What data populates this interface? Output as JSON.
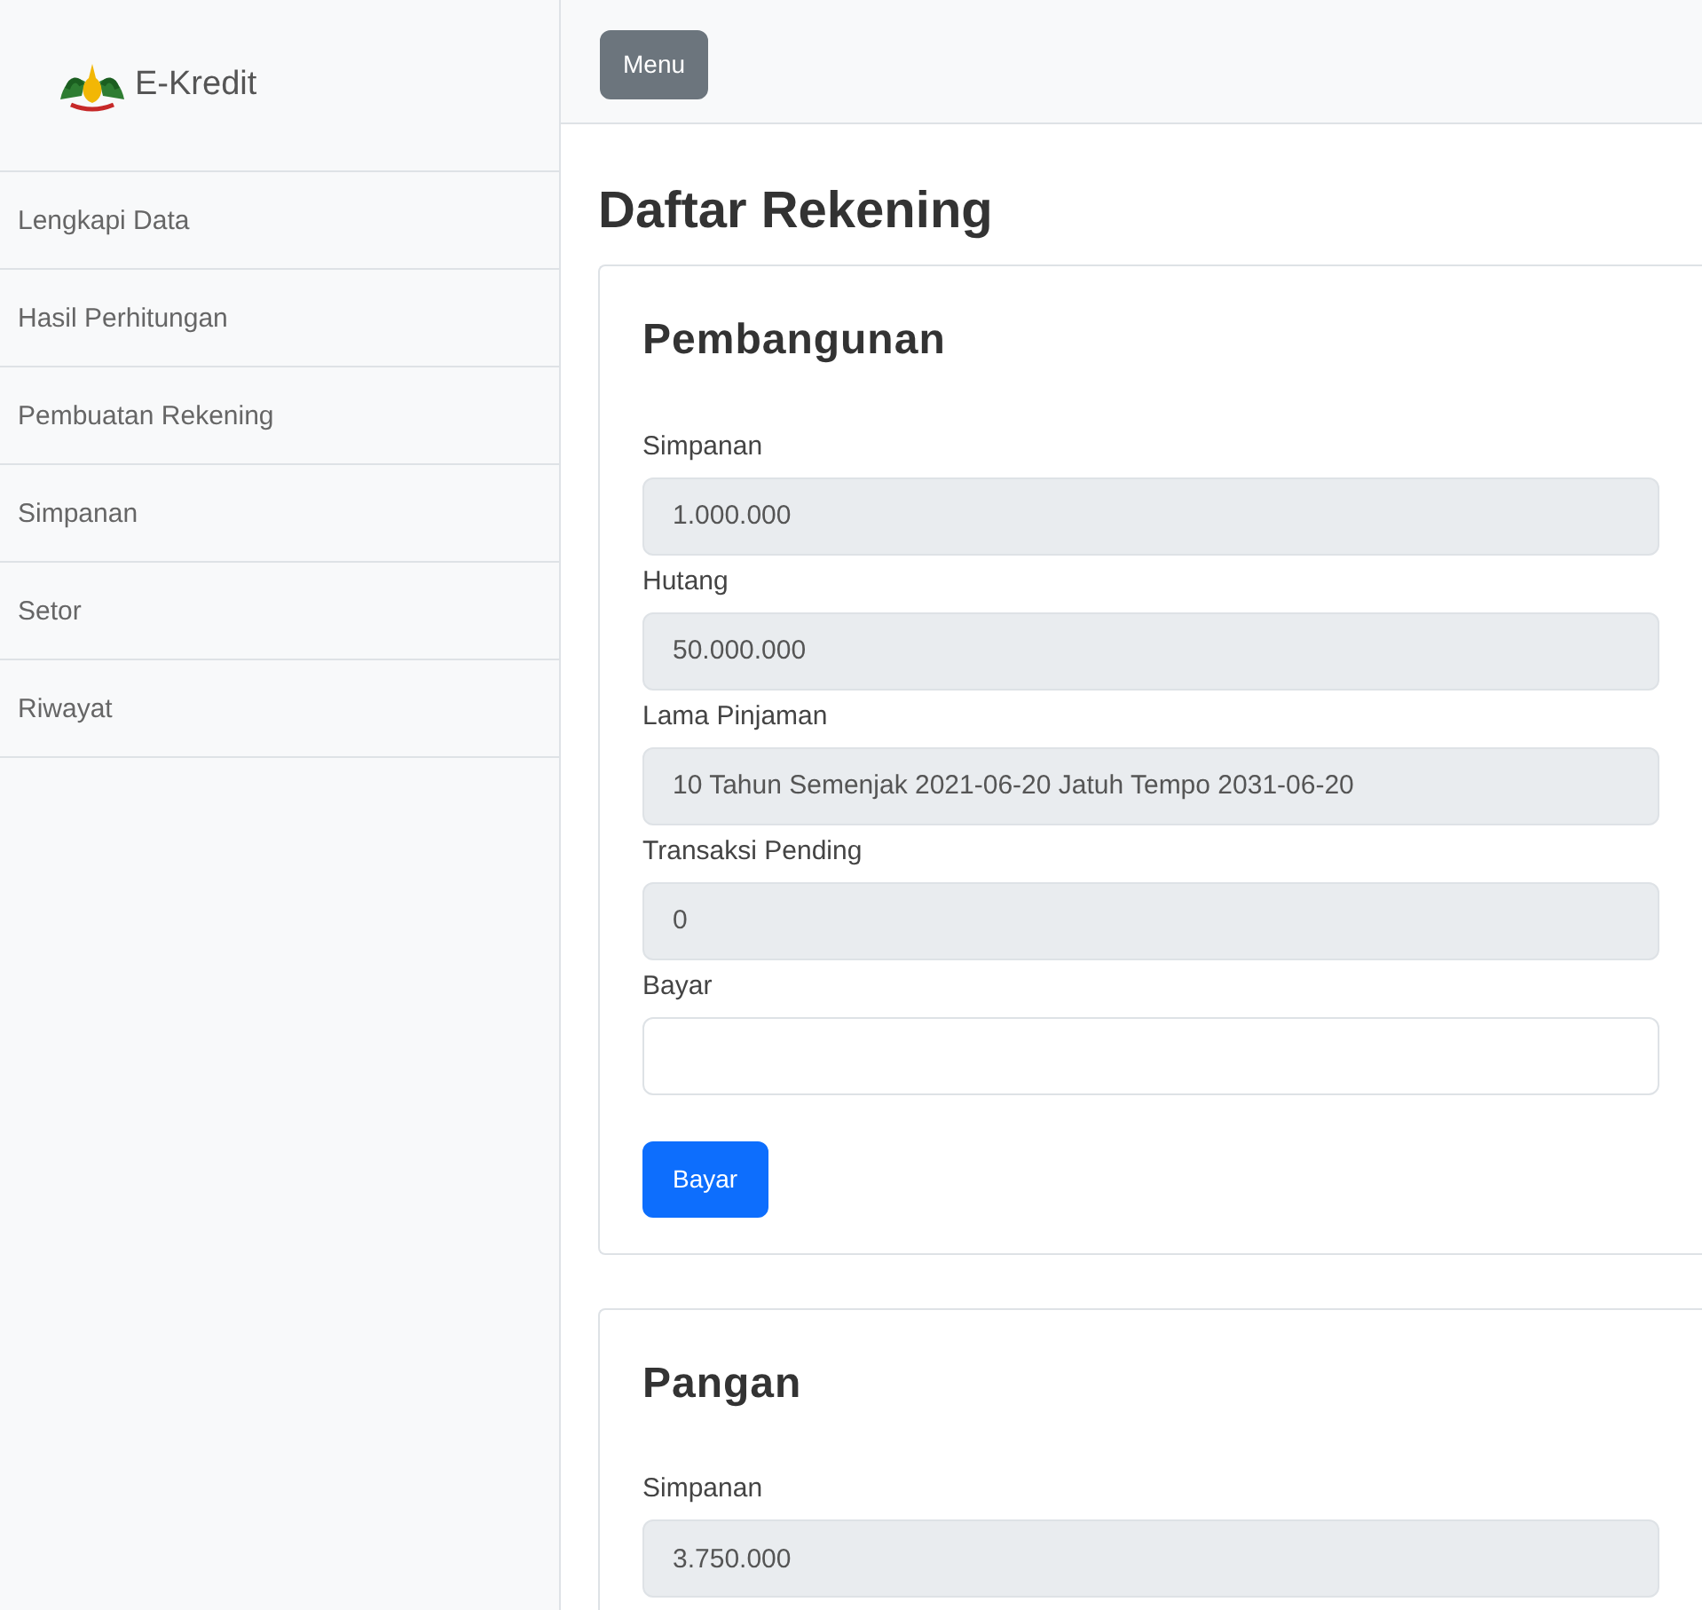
{
  "sidebar": {
    "brand": "E-Kredit",
    "items": [
      {
        "label": "Lengkapi Data"
      },
      {
        "label": "Hasil Perhitungan"
      },
      {
        "label": "Pembuatan Rekening"
      },
      {
        "label": "Simpanan"
      },
      {
        "label": "Setor"
      },
      {
        "label": "Riwayat"
      }
    ]
  },
  "menu_button": "Menu",
  "page_title": "Daftar Rekening",
  "accounts": [
    {
      "title": "Pembangunan",
      "fields": [
        {
          "label": "Simpanan",
          "value": "1.000.000",
          "disabled": true
        },
        {
          "label": "Hutang",
          "value": "50.000.000",
          "disabled": true
        },
        {
          "label": "Lama Pinjaman",
          "value": "10 Tahun Semenjak 2021-06-20 Jatuh Tempo 2031-06-20",
          "disabled": true
        },
        {
          "label": "Transaksi Pending",
          "value": "0",
          "disabled": true
        },
        {
          "label": "Bayar",
          "disabled": false
        }
      ],
      "button": "Bayar"
    },
    {
      "title": "Pangan",
      "fields": [
        {
          "label": "Simpanan",
          "value": "3.750.000",
          "disabled": true
        }
      ]
    }
  ]
}
